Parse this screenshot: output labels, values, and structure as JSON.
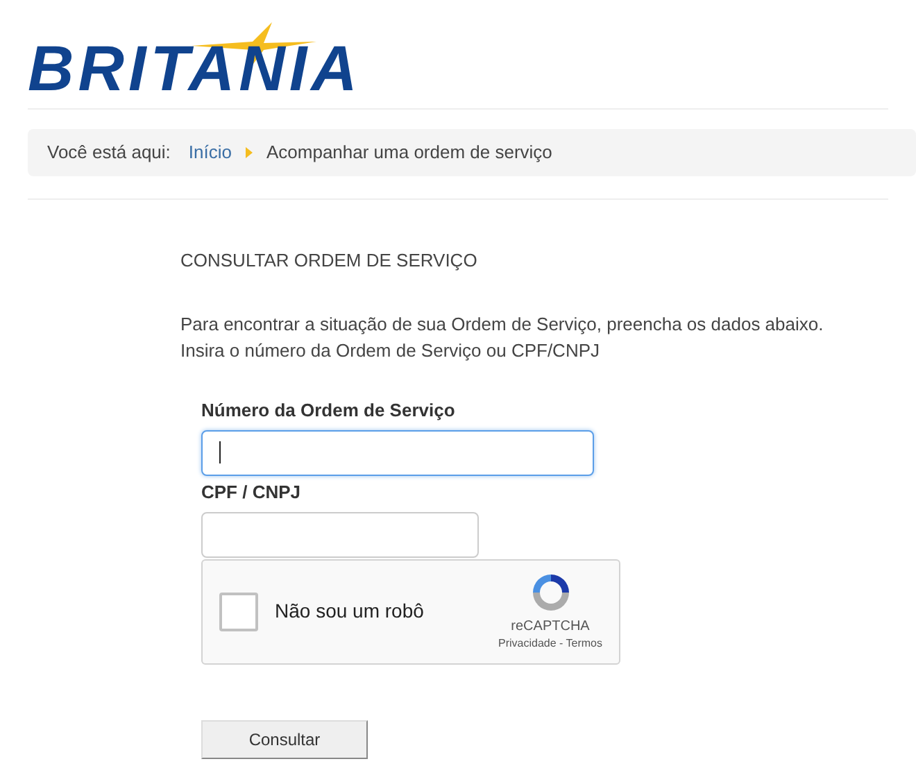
{
  "logo": {
    "text": "BRITANIA"
  },
  "breadcrumb": {
    "prefix": "Você está aqui:",
    "items": [
      {
        "label": "Início",
        "kind": "link"
      },
      {
        "label": "Acompanhar uma ordem de serviço",
        "kind": "current"
      }
    ]
  },
  "heading": "CONSULTAR ORDEM DE SERVIÇO",
  "intro": [
    "Para encontrar a situação de sua Ordem de Serviço, preencha os dados abaixo.",
    "Insira o número da Ordem de Serviço ou CPF/CNPJ"
  ],
  "fields": [
    {
      "label": "Número da Ordem de Serviço",
      "focused": true,
      "kind": "wide"
    },
    {
      "label": "CPF / CNPJ",
      "focused": false,
      "kind": "narrow"
    }
  ],
  "captcha": {
    "label": "Não sou um robô",
    "checked": false,
    "brand": "reCAPTCHA",
    "links": "Privacidade - Termos"
  },
  "submit": "Consultar"
}
